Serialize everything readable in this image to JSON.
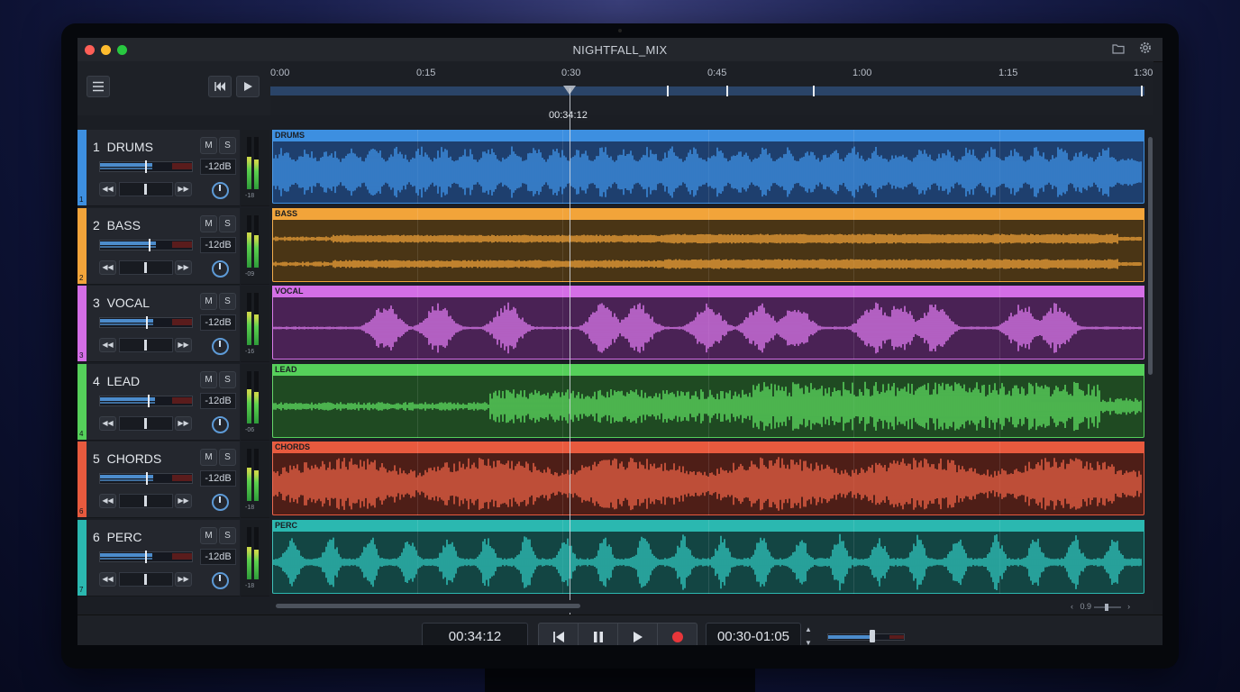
{
  "window": {
    "title": "NIGHTFALL_MIX",
    "traffic_colors": [
      "#ff5f57",
      "#febc2e",
      "#28c840"
    ]
  },
  "ruler": {
    "labels": [
      "0:00",
      "0:15",
      "0:30",
      "0:45",
      "1:00",
      "1:15",
      "1:30"
    ],
    "playhead_time": "00:34:12"
  },
  "tracks": [
    {
      "num": "1",
      "name": "DRUMS",
      "clip": "DRUMS",
      "db": "-12dB",
      "meter_label": "-18",
      "strip_num": "1",
      "color": "#3d8fe0",
      "fill": "#1e3f6e",
      "wave": "#3f93e8",
      "level": 0.72,
      "pan": 0.5
    },
    {
      "num": "2",
      "name": "BASS",
      "clip": "BASS",
      "db": "-12dB",
      "meter_label": "-09",
      "strip_num": "2",
      "color": "#f2a43a",
      "fill": "#4a3515",
      "wave": "#f2a43a",
      "level": 0.78,
      "pan": 0.5
    },
    {
      "num": "3",
      "name": "VOCAL",
      "clip": "VOCAL",
      "db": "-12dB",
      "meter_label": "-16",
      "strip_num": "3",
      "color": "#d46ee6",
      "fill": "#4a2255",
      "wave": "#df7af0",
      "level": 0.74,
      "pan": 0.5
    },
    {
      "num": "4",
      "name": "LEAD",
      "clip": "LEAD",
      "db": "-12dB",
      "meter_label": "-06",
      "strip_num": "4",
      "color": "#55d05a",
      "fill": "#1f4a22",
      "wave": "#5fe062",
      "level": 0.76,
      "pan": 0.5
    },
    {
      "num": "5",
      "name": "CHORDS",
      "clip": "CHORDS",
      "db": "-12dB",
      "meter_label": "-18",
      "strip_num": "6",
      "color": "#e85a3e",
      "fill": "#4e1e17",
      "wave": "#ee6347",
      "level": 0.74,
      "pan": 0.5
    },
    {
      "num": "6",
      "name": "PERC",
      "clip": "PERC",
      "db": "-12dB",
      "meter_label": "-18",
      "strip_num": "7",
      "color": "#2bb8b0",
      "fill": "#134543",
      "wave": "#30c8bf",
      "level": 0.72,
      "pan": 0.5
    }
  ],
  "labels": {
    "mute": "M",
    "solo": "S",
    "zoom": "0.9"
  },
  "transport": {
    "position": "00:34:12",
    "loop_range": "00:30-01:05",
    "volume": 0.6
  },
  "icons": {
    "menu": "menu-icon",
    "rewind": "skip-back-icon",
    "play": "play-icon",
    "folder": "folder-icon",
    "settings": "gear-icon",
    "pause": "pause-icon",
    "record": "record-icon"
  }
}
